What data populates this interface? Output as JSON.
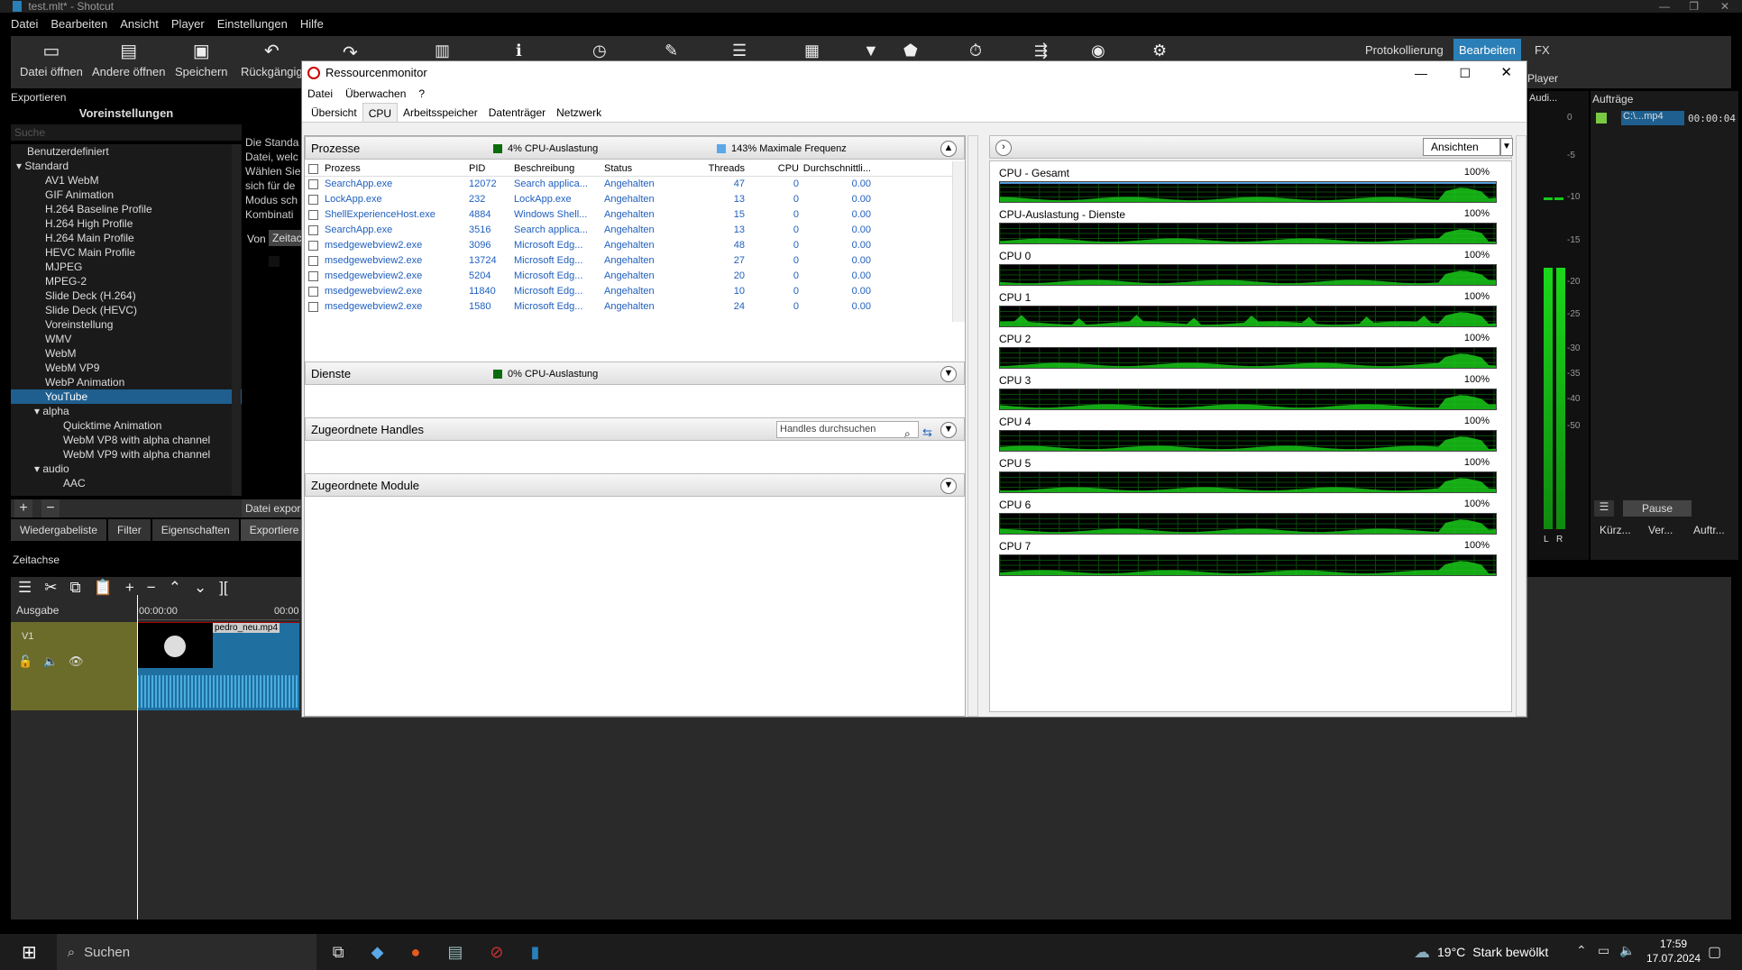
{
  "shotcut": {
    "window_title": "test.mlt* - Shotcut",
    "menu": [
      "Datei",
      "Bearbeiten",
      "Ansicht",
      "Player",
      "Einstellungen",
      "Hilfe"
    ],
    "toolbar": {
      "open_file": "Datei öffnen",
      "open_other": "Andere öffnen",
      "save": "Speichern",
      "undo": "Rückgängig"
    },
    "layout_tabs": {
      "logging": "Protokollierung",
      "edit": "Bearbeiten",
      "fx": "FX"
    },
    "export_panel_title": "Exportieren",
    "presets_title": "Voreinstellungen",
    "search_placeholder": "Suche",
    "presets": [
      {
        "label": "Benutzerdefiniert",
        "level": 0
      },
      {
        "label": "Standard",
        "level": 0
      },
      {
        "label": "AV1 WebM",
        "level": 1
      },
      {
        "label": "GIF Animation",
        "level": 1
      },
      {
        "label": "H.264 Baseline Profile",
        "level": 1
      },
      {
        "label": "H.264 High Profile",
        "level": 1
      },
      {
        "label": "H.264 Main Profile",
        "level": 1
      },
      {
        "label": "HEVC Main Profile",
        "level": 1
      },
      {
        "label": "MJPEG",
        "level": 1
      },
      {
        "label": "MPEG-2",
        "level": 1
      },
      {
        "label": "Slide Deck (H.264)",
        "level": 1
      },
      {
        "label": "Slide Deck (HEVC)",
        "level": 1
      },
      {
        "label": "Voreinstellung",
        "level": 1
      },
      {
        "label": "WMV",
        "level": 1
      },
      {
        "label": "WebM",
        "level": 1
      },
      {
        "label": "WebM VP9",
        "level": 1
      },
      {
        "label": "WebP Animation",
        "level": 1
      },
      {
        "label": "YouTube",
        "level": 1
      },
      {
        "label": "alpha",
        "level": 1
      },
      {
        "label": "Quicktime Animation",
        "level": 2
      },
      {
        "label": "WebM VP8 with alpha channel",
        "level": 2
      },
      {
        "label": "WebM VP9 with alpha channel",
        "level": 2
      },
      {
        "label": "audio",
        "level": 1
      },
      {
        "label": "AAC",
        "level": 2
      }
    ],
    "export_desc": [
      "Die Standa",
      "Datei, welc",
      "Wählen Sie",
      "sich für de",
      "Modus sch",
      "Kombinati"
    ],
    "von_label": "Von",
    "von_value": "Zeitac",
    "export_file_btn": "Datei expor",
    "bottom_tabs": [
      "Wiedergabeliste",
      "Filter",
      "Eigenschaften",
      "Exportiere"
    ],
    "timeline_title": "Zeitachse",
    "output_label": "Ausgabe",
    "track_v1": "V1",
    "time_start": "00:00:00",
    "time_next": "00:00",
    "clip_name": "pedro_neu.mp4",
    "player_label": "Player",
    "audio_label": "Audi...",
    "meter_ticks": [
      "0",
      "-5",
      "-10",
      "-15",
      "-20",
      "-25",
      "-30",
      "-35",
      "-40",
      "-50"
    ],
    "meter_lr": [
      "L",
      "R"
    ],
    "jobs_title": "Aufträge",
    "job_file": "C:\\...mp4",
    "job_time": "00:00:04",
    "pause_label": "Pause",
    "jobs_tabs": [
      "Kürz...",
      "Ver...",
      "Auftr..."
    ]
  },
  "resmon": {
    "title": "Ressourcenmonitor",
    "menu": [
      "Datei",
      "Überwachen",
      "?"
    ],
    "tabs": [
      "Übersicht",
      "CPU",
      "Arbeitsspeicher",
      "Datenträger",
      "Netzwerk"
    ],
    "active_tab": "CPU",
    "processes": {
      "title": "Prozesse",
      "cpu_usage": "4% CPU-Auslastung",
      "max_freq": "143% Maximale Frequenz",
      "columns": [
        "Prozess",
        "PID",
        "Beschreibung",
        "Status",
        "Threads",
        "CPU",
        "Durchschnittli..."
      ],
      "rows": [
        [
          "SearchApp.exe",
          "12072",
          "Search applica...",
          "Angehalten",
          "47",
          "0",
          "0.00"
        ],
        [
          "LockApp.exe",
          "232",
          "LockApp.exe",
          "Angehalten",
          "13",
          "0",
          "0.00"
        ],
        [
          "ShellExperienceHost.exe",
          "4884",
          "Windows Shell...",
          "Angehalten",
          "15",
          "0",
          "0.00"
        ],
        [
          "SearchApp.exe",
          "3516",
          "Search applica...",
          "Angehalten",
          "13",
          "0",
          "0.00"
        ],
        [
          "msedgewebview2.exe",
          "3096",
          "Microsoft Edg...",
          "Angehalten",
          "48",
          "0",
          "0.00"
        ],
        [
          "msedgewebview2.exe",
          "13724",
          "Microsoft Edg...",
          "Angehalten",
          "27",
          "0",
          "0.00"
        ],
        [
          "msedgewebview2.exe",
          "5204",
          "Microsoft Edg...",
          "Angehalten",
          "20",
          "0",
          "0.00"
        ],
        [
          "msedgewebview2.exe",
          "11840",
          "Microsoft Edg...",
          "Angehalten",
          "10",
          "0",
          "0.00"
        ],
        [
          "msedgewebview2.exe",
          "1580",
          "Microsoft Edg...",
          "Angehalten",
          "24",
          "0",
          "0.00"
        ]
      ]
    },
    "services": {
      "title": "Dienste",
      "cpu_usage": "0% CPU-Auslastung"
    },
    "handles": {
      "title": "Zugeordnete Handles",
      "search_placeholder": "Handles durchsuchen"
    },
    "modules": {
      "title": "Zugeordnete Module"
    },
    "views_button": "Ansichten",
    "graphs": [
      {
        "label": "CPU - Gesamt",
        "pct": "100%"
      },
      {
        "label": "CPU-Auslastung - Dienste",
        "pct": "100%"
      },
      {
        "label": "CPU 0",
        "pct": "100%"
      },
      {
        "label": "CPU 1",
        "pct": "100%"
      },
      {
        "label": "CPU 2",
        "pct": "100%"
      },
      {
        "label": "CPU 3",
        "pct": "100%"
      },
      {
        "label": "CPU 4",
        "pct": "100%"
      },
      {
        "label": "CPU 5",
        "pct": "100%"
      },
      {
        "label": "CPU 6",
        "pct": "100%"
      },
      {
        "label": "CPU 7",
        "pct": "100%"
      }
    ],
    "colors": {
      "graph_green": "#19c819",
      "graph_bg": "#000000",
      "link_blue": "#1f5fbf"
    }
  },
  "taskbar": {
    "search": "Suchen",
    "weather_temp": "19°C",
    "weather_text": "Stark bewölkt",
    "time": "17:59",
    "date": "17.07.2024"
  }
}
